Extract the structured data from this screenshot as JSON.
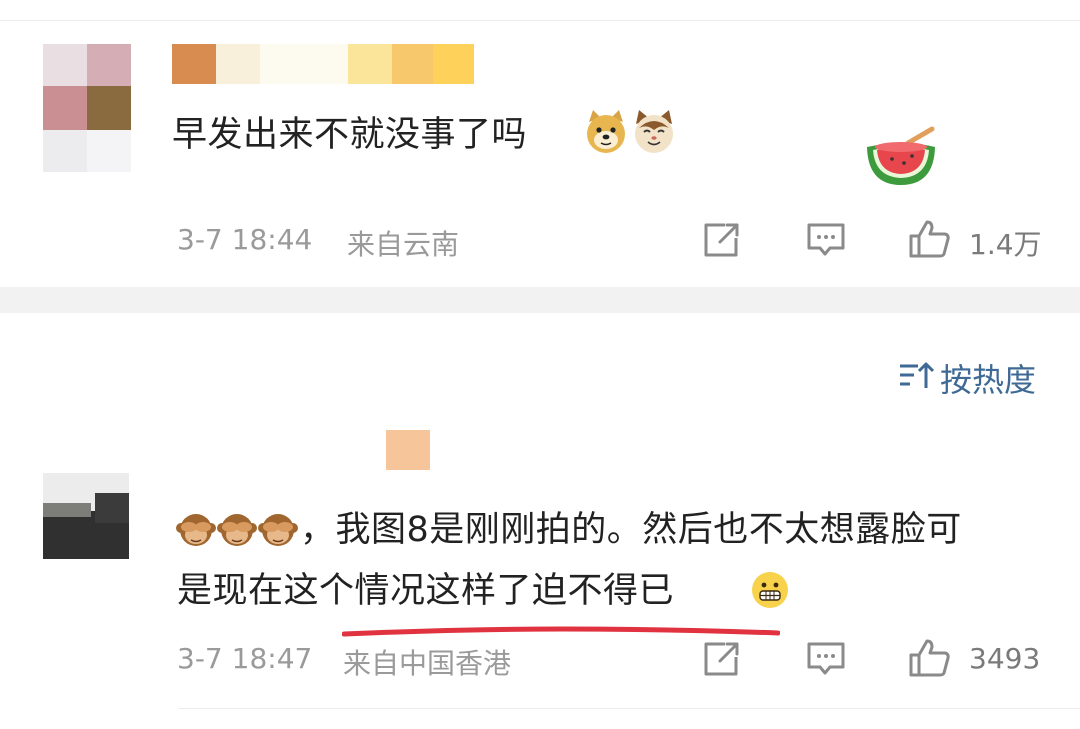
{
  "comments": [
    {
      "text": "早发出来不就没事了吗",
      "emojis": [
        "doge-emoji",
        "cat-emoji"
      ],
      "sticker": "watermelon-sticker",
      "date": "3-7 18:44",
      "location": "来自云南",
      "like_count": "1.4万"
    },
    {
      "emojis": [
        "see-no-evil-monkey-emoji",
        "see-no-evil-monkey-emoji",
        "see-no-evil-monkey-emoji"
      ],
      "text_line1": "，我图8是刚刚拍的。然后也不太想露脸可",
      "text_line2": "是现在这个情况这样了迫不得已",
      "trailing_emoji": "grimacing-emoji",
      "date": "3-7 18:47",
      "location": "来自中国香港",
      "like_count": "3493"
    }
  ],
  "sort": {
    "label": "按热度",
    "icon": "sort-icon"
  },
  "actions": {
    "share_icon": "share-icon",
    "reply_icon": "comment-icon",
    "like_icon": "thumbs-up-icon"
  },
  "colors": {
    "accent_blue": "#3f6a96",
    "highlight_red": "#e0333f",
    "meta_gray": "#9a9a9a",
    "separator": "#f2f2f2"
  }
}
